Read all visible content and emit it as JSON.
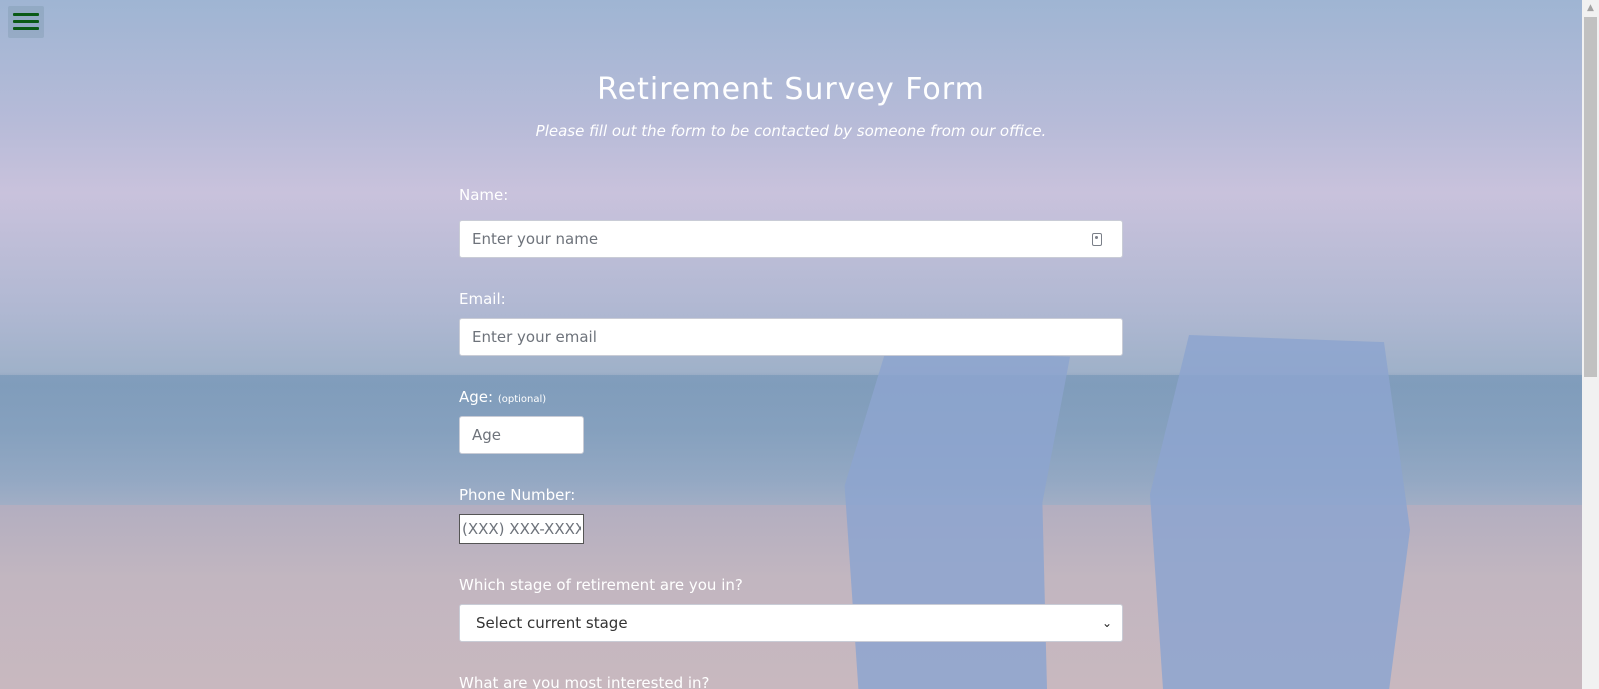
{
  "header": {
    "title": "Retirement Survey Form",
    "subtitle": "Please fill out the form to be contacted by someone from our office."
  },
  "menu": {
    "icon": "hamburger-menu-icon"
  },
  "form": {
    "name": {
      "label": "Name:",
      "placeholder": "Enter your name",
      "icon": "contact-card-icon"
    },
    "email": {
      "label": "Email:",
      "placeholder": "Enter your email"
    },
    "age": {
      "label": "Age:",
      "note": "(optional)",
      "placeholder": "Age"
    },
    "phone": {
      "label": "Phone Number:",
      "placeholder": "(XXX) XXX-XXXX"
    },
    "stage": {
      "label": "Which stage of retirement are you in?",
      "selected": "Select current stage"
    },
    "interest": {
      "label": "What are you most interested in?"
    }
  },
  "colors": {
    "text": "#ffffff",
    "menu_icon": "#0b5a16"
  }
}
